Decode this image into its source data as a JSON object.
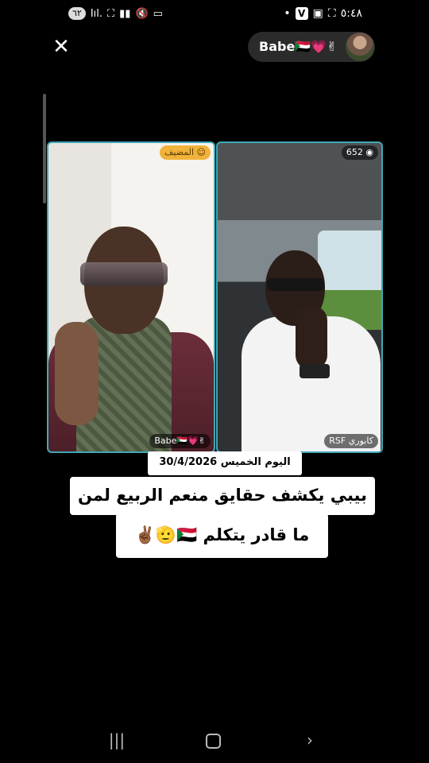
{
  "status_bar": {
    "time": "٥:٤٨",
    "notification_count": "٦٢",
    "signal_text": "Iıl.",
    "v_badge": "V",
    "dot": "•"
  },
  "header": {
    "close_icon": "close-icon",
    "host_name": "Babe🇸🇩💗✌"
  },
  "panels": {
    "left": {
      "role_badge": "المضيف",
      "name_badge": "Babe🇸🇩💗✌"
    },
    "right": {
      "viewer_count": "652",
      "name_badge": "RSF كابوري"
    }
  },
  "overlay": {
    "date_line": "اليوم الخميس 30/4/2026",
    "caption_line1": "بيبي يكشف حقايق منعم الربيع لمن",
    "caption_line2": "ما قادر يتكلم 🇸🇩🫡✌🏾"
  },
  "navigation": {
    "recent_icon": "recent-apps-icon",
    "home_icon": "home-icon",
    "back_icon": "back-icon"
  }
}
